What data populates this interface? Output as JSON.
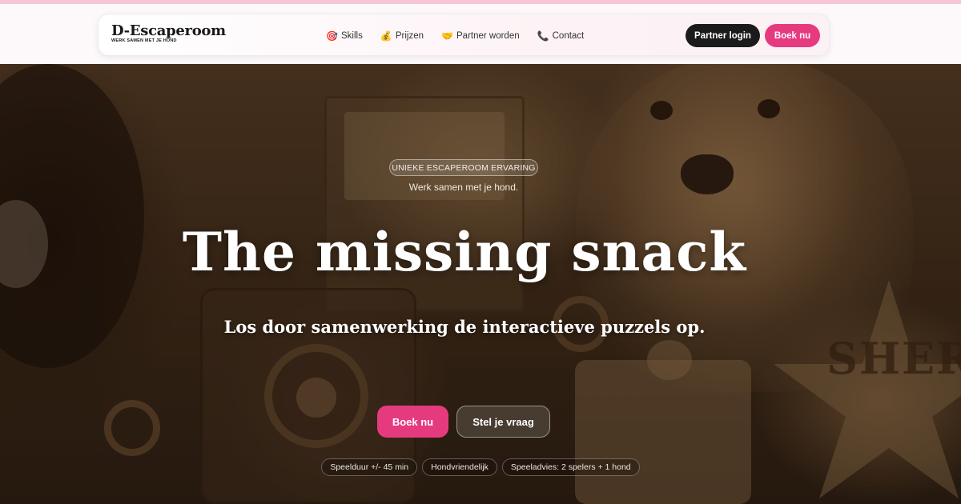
{
  "brand": {
    "name": "D-Escaperoom",
    "tagline": "WERK SAMEN MET JE HOND"
  },
  "nav": {
    "items": [
      {
        "icon": "🎯",
        "icon_name": "target-icon",
        "label": "Skills"
      },
      {
        "icon": "💰",
        "icon_name": "money-bag-icon",
        "label": "Prijzen"
      },
      {
        "icon": "🤝",
        "icon_name": "handshake-icon",
        "label": "Partner worden"
      },
      {
        "icon": "📞",
        "icon_name": "phone-icon",
        "label": "Contact"
      }
    ],
    "partner_login": "Partner login",
    "book": "Boek nu"
  },
  "hero": {
    "badge": "UNIEKE ESCAPEROOM ERVARING",
    "subtitle": "Werk samen met je hond.",
    "title": "The missing snack",
    "tagline": "Los door samenwerking de interactieve puzzels op.",
    "primary_button": "Boek nu",
    "secondary_button": "Stel je vraag",
    "chips": [
      "Speelduur +/- 45 min",
      "Hondvriendelijk",
      "Speeladvies: 2 spelers + 1 hond"
    ],
    "image_text": "SHERIF"
  },
  "colors": {
    "accent": "#e63a7f",
    "dark": "#1b1b1b",
    "top_strip": "#f7c6d4"
  }
}
